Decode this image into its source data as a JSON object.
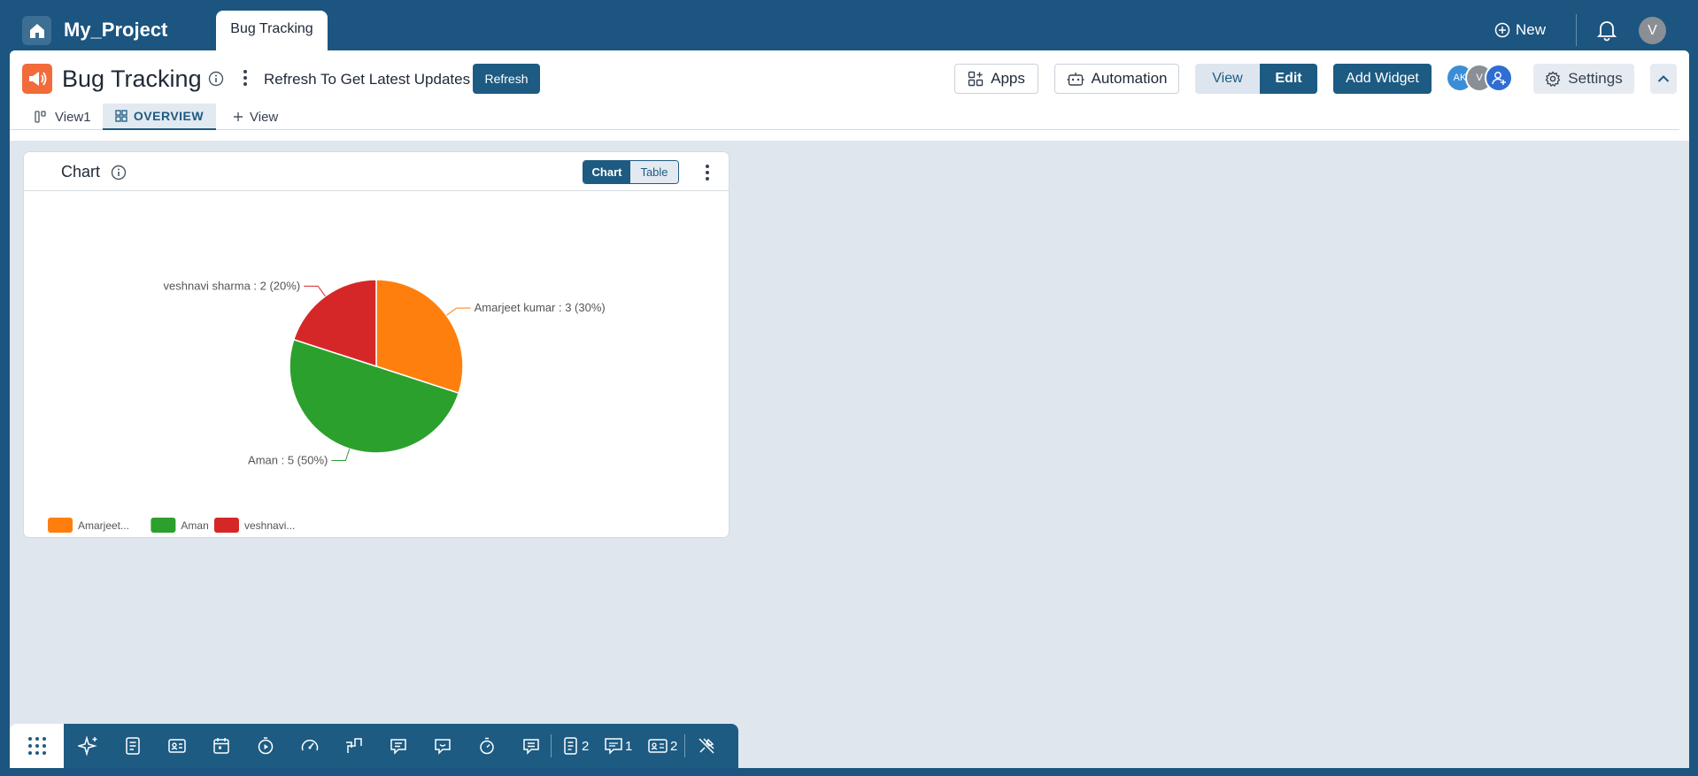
{
  "topbar": {
    "project_name": "My_Project",
    "active_tab": "Bug Tracking",
    "new_label": "New",
    "user_initial": "V"
  },
  "header": {
    "title": "Bug Tracking",
    "refresh_text": "Refresh To Get Latest Updates",
    "refresh_label": "Refresh",
    "apps_label": "Apps",
    "automation_label": "Automation",
    "view_label": "View",
    "edit_label": "Edit",
    "add_widget_label": "Add Widget",
    "avatars": [
      "AK",
      "V"
    ],
    "settings_label": "Settings"
  },
  "view_tabs": {
    "tab1": "View1",
    "tab2": "OVERVIEW",
    "add": "View"
  },
  "widget": {
    "title": "Chart",
    "toggle_chart": "Chart",
    "toggle_table": "Table"
  },
  "chart_data": {
    "type": "pie",
    "slices": [
      {
        "name": "Amarjeet kumar",
        "value": 3,
        "percent": 30,
        "color": "#ff7f0e",
        "label": "Amarjeet kumar : 3 (30%)",
        "legend": "Amarjeet..."
      },
      {
        "name": "Aman",
        "value": 5,
        "percent": 50,
        "color": "#2ca02c",
        "label": "Aman : 5 (50%)",
        "legend": "Aman"
      },
      {
        "name": "veshnavi sharma",
        "value": 2,
        "percent": 20,
        "color": "#d62728",
        "label": "veshnavi sharma : 2 (20%)",
        "legend": "veshnavi..."
      }
    ],
    "legend_position": "bottom-left"
  },
  "dock": {
    "counts": [
      "2",
      "1",
      "2"
    ],
    "icons": [
      "ai-sparkle-icon",
      "document-icon",
      "id-card-icon",
      "calendar-icon",
      "play-circle-icon",
      "gauge-icon",
      "chat-flow-icon",
      "message-icon",
      "chat-bubble-icon",
      "timer-icon",
      "comment-icon"
    ]
  }
}
